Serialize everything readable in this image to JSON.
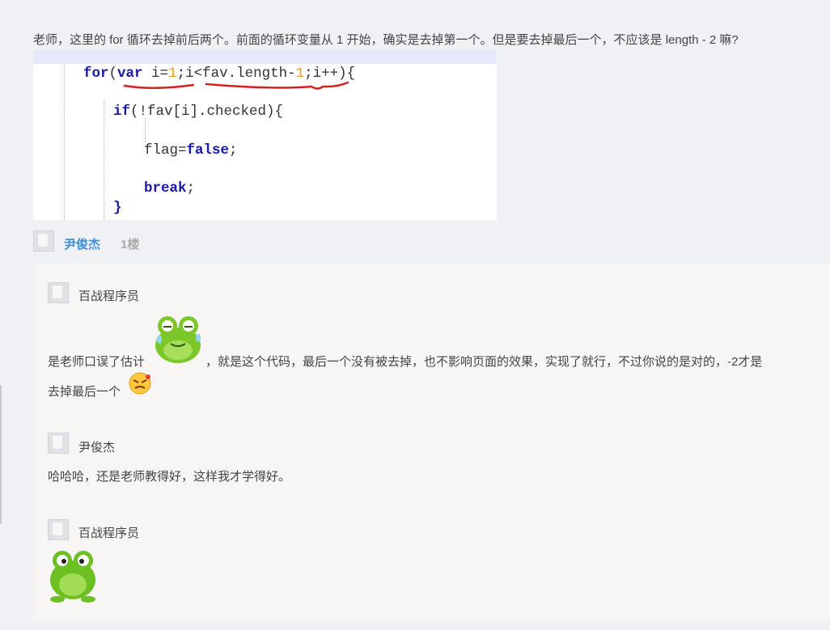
{
  "question": {
    "text": "老师，这里的 for 循环去掉前后两个。前面的循环变量从 1 开始，确实是去掉第一个。但是要去掉最后一个，不应该是 length - 2 嘛?"
  },
  "code": {
    "line1": {
      "kw1": "for",
      "p1": "(",
      "kw2": "var",
      "p2": " i=",
      "n1": "1",
      "p3": ";i<fav.length-",
      "n2": "1",
      "p4": ";i++){"
    },
    "line2": {
      "kw": "if",
      "rest": "(!fav[i].checked){"
    },
    "line3": {
      "pre": "flag=",
      "kw": "false",
      "post": ";"
    },
    "line4": {
      "kw": "break",
      "post": ";"
    },
    "line5": "}"
  },
  "reply": {
    "user": "尹俊杰",
    "floor": "1楼"
  },
  "comments": [
    {
      "name": "百战程序员",
      "text_a": "是老师口误了估计",
      "text_b": "，就是这个代码，最后一个没有被去掉，也不影响页面的效果，实现了就行，不过你说的是对的，-2才是",
      "text_c": "去掉最后一个"
    },
    {
      "name": "尹俊杰",
      "text": "哈哈哈，还是老师教得好，这样我才学得好。"
    },
    {
      "name": "百战程序员"
    }
  ],
  "icons": {
    "avatar": "user-avatar-placeholder",
    "emoji1": "frog-sweat-emoji",
    "emoji2": "angry-face-emoji",
    "emoji3": "frog-emoji"
  },
  "colors": {
    "link": "#3c8de0",
    "keyword": "#1a1aa8",
    "number": "#f29a22",
    "underline": "#d42020"
  }
}
